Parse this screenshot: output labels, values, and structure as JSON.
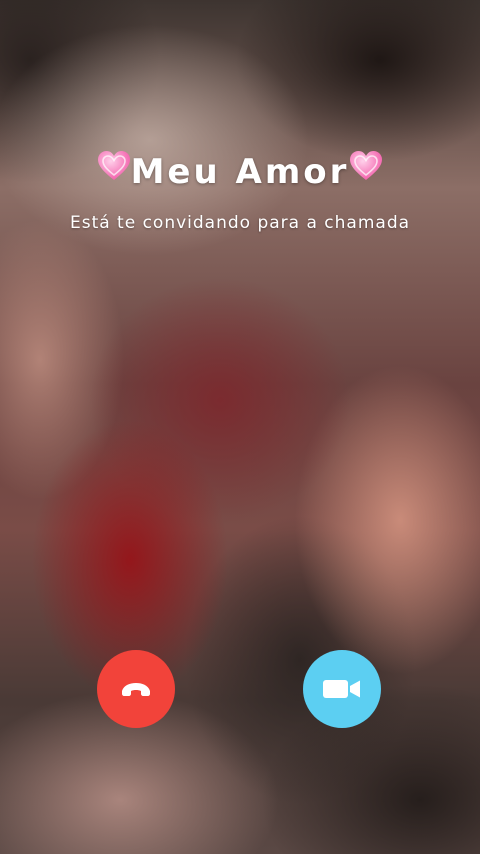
{
  "caller": {
    "name": "Meu Amor",
    "decor_icon": "heart-icon"
  },
  "status": {
    "text": "Está te convidando para a chamada"
  },
  "actions": {
    "decline": {
      "icon": "phone-hangup-icon",
      "color": "#f2433a"
    },
    "accept": {
      "icon": "video-camera-icon",
      "color": "#5ccff2"
    }
  }
}
